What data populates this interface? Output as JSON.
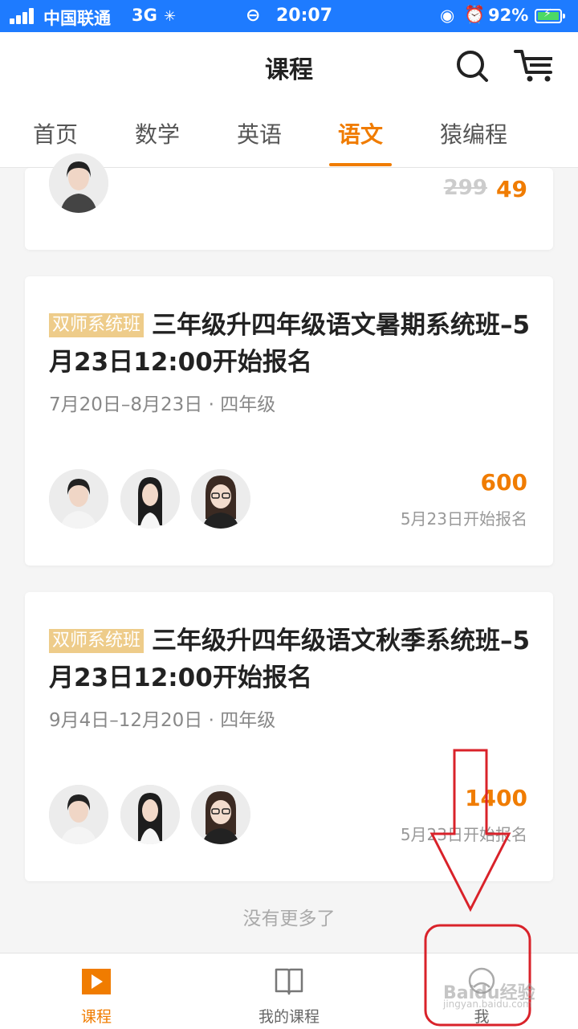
{
  "status_bar": {
    "carrier": "中国联通",
    "network": "3G",
    "time": "20:07",
    "battery_percent": "92%"
  },
  "header": {
    "title": "课程",
    "icons": [
      "search-icon",
      "cart-icon"
    ]
  },
  "tabs": [
    {
      "label": "首页",
      "active": false
    },
    {
      "label": "数学",
      "active": false
    },
    {
      "label": "英语",
      "active": false
    },
    {
      "label": "语文",
      "active": true
    },
    {
      "label": "猿编程",
      "active": false
    }
  ],
  "top_card": {
    "old_price": "299",
    "price": "49"
  },
  "courses": [
    {
      "badge": "双师系统班",
      "title": "三年级升四年级语文暑期系统班–5月23日12:00开始报名",
      "meta": "7月20日–8月23日 · 四年级",
      "price": "600",
      "enroll": "5月23日开始报名"
    },
    {
      "badge": "双师系统班",
      "title": "三年级升四年级语文秋季系统班–5月23日12:00开始报名",
      "meta": "9月4日–12月20日 · 四年级",
      "price": "1400",
      "enroll": "5月23日开始报名"
    }
  ],
  "no_more": "没有更多了",
  "bottom_nav": [
    {
      "label": "课程",
      "icon": "play-icon",
      "active": true
    },
    {
      "label": "我的课程",
      "icon": "book-icon",
      "active": false
    },
    {
      "label": "我",
      "icon": "user-icon",
      "active": false
    }
  ],
  "watermark": {
    "text": "Baidu经验",
    "sub": "jingyan.baidu.com"
  },
  "colors": {
    "accent": "#f07c00",
    "status_bar": "#1e7bff",
    "annotation": "#d9222a",
    "badge": "#eecc8a"
  }
}
